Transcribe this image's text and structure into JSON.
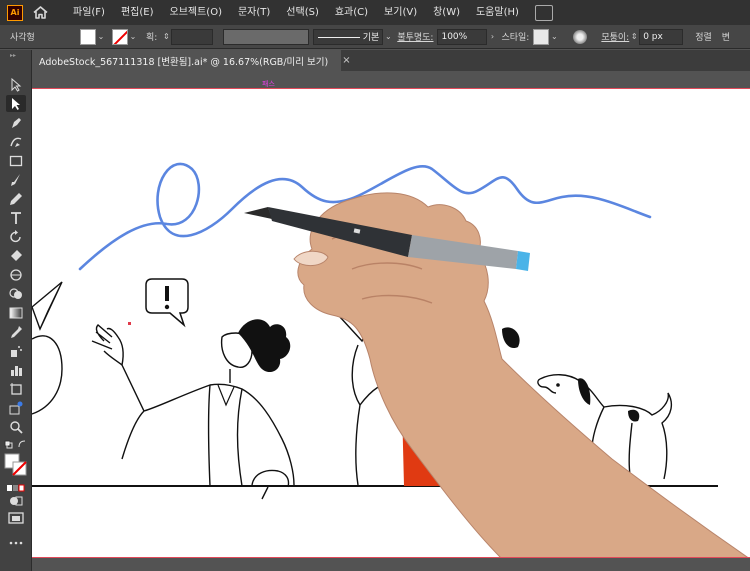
{
  "app": {
    "logo_text": "Ai"
  },
  "menu": {
    "items": [
      "파일(F)",
      "편집(E)",
      "오브젝트(O)",
      "문자(T)",
      "선택(S)",
      "효과(C)",
      "보기(V)",
      "창(W)",
      "도움말(H)"
    ]
  },
  "control_bar": {
    "object_type": "사각형",
    "width_label": "획:",
    "stroke_style": "기본",
    "opacity_label": "불투명도:",
    "opacity_value": "100%",
    "style_label": "스타일:",
    "corner_label": "모퉁이:",
    "corner_value": "0 px",
    "align_label": "정렬",
    "transform_label": "변"
  },
  "document": {
    "tab_title": "AdobeStock_567111318 [변환됨].ai* @ 16.67%(RGB/미리 보기)",
    "close": "×"
  },
  "canvas": {
    "path_hint": "패스"
  },
  "colors": {
    "menubar_bg": "#323232",
    "panel_bg": "#424242",
    "accent_red": "#e03a12",
    "squiggle_blue": "#5b86e0",
    "artboard_border": "#e24a5a"
  },
  "icons": [
    "home-icon",
    "selection-icon",
    "direct-selection-icon",
    "pen-icon",
    "curvature-icon",
    "rectangle-icon",
    "paintbrush-icon",
    "pencil-icon",
    "type-icon",
    "rotate-icon",
    "eraser-icon",
    "width-icon",
    "shape-builder-icon",
    "gradient-icon",
    "eyedropper-icon",
    "symbol-sprayer-icon",
    "artboard-icon",
    "graph-icon",
    "zoom-icon",
    "hand-icon",
    "fill-stroke-icon",
    "draw-mode-icon",
    "screen-mode-icon",
    "more-tools-icon"
  ]
}
